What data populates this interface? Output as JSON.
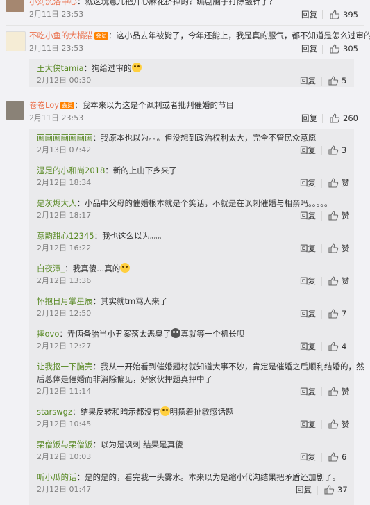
{
  "labels": {
    "reply": "回复"
  },
  "top_comments": [
    {
      "user": "小刘洗浴中心",
      "badge": "",
      "text": "：就这玩意儿把开心麻花挤掉的？编剧脑子打除皱针了？",
      "time": "2月11日 23:53",
      "likes": "395"
    },
    {
      "user": "不吃小鱼的大橘猫",
      "badge": "会员",
      "text": "：这小品去年被毙了，今年还能上，我是真的服气，都不知道是怎么过审的",
      "time": "2月11日 23:53",
      "likes": "305"
    },
    {
      "user": "卷卷Loy",
      "badge": "会员",
      "text": "：我本来以为这是个讽刺或者批判催婚的节目",
      "time": "2月11日 23:53",
      "likes": "260"
    }
  ],
  "replies_a": [
    {
      "user": "王大侠tamia",
      "text": "：狗给过审的",
      "time": "2月12日 00:30",
      "likes": "5",
      "emoji": "😆"
    }
  ],
  "replies_b": [
    {
      "user": "画画画画画画画",
      "text": "：我原本也以为。。。但没想到政治权利太大，完全不管民众意愿",
      "time": "2月13日 07:42",
      "likes": "3"
    },
    {
      "user": "湿足的小和尚2018",
      "text": "：新的上山下乡来了",
      "time": "2月12日 18:34",
      "likes": "赞"
    },
    {
      "user": "是灰烬大人",
      "text": "：小品中父母的催婚根本就是个笑话，不就是在讽刺催婚与相亲吗。。。。。",
      "time": "2月12日 18:17",
      "likes": "赞"
    },
    {
      "user": "意韵甜心12345",
      "text": "：我也这么以为。。。",
      "time": "2月12日 16:22",
      "likes": "赞"
    },
    {
      "user": "白夜潭_",
      "text": "：我真傻...真的",
      "time": "2月12日 13:36",
      "likes": "赞",
      "emoji": "😄"
    },
    {
      "user": "怀抱日月掌星辰",
      "text": "：其实就tm骂人来了",
      "time": "2月12日 12:50",
      "likes": "7"
    },
    {
      "user": "摔ovo",
      "text": "：弄俩备胎当小丑案落太恶臭了",
      "text2": "真就等一个机长呗",
      "time": "2月12日 12:27",
      "likes": "4",
      "emoji": "😱"
    },
    {
      "user": "让我抠一下脑壳",
      "text": "：我从一开始看到催婚题材就知道大事不妙，肯定是催婚之后顺利结婚的，然",
      "text_line2": "后总体是催婚而非消除偏见，好家伙押题真押中了",
      "time": "2月12日 11:14",
      "likes": "赞"
    },
    {
      "user": "starswgz",
      "text": "：结果反转和暗示都没有",
      "text2": "明摆着扯敏感话题",
      "time": "2月12日 10:45",
      "likes": "赞",
      "emoji": "😓"
    },
    {
      "user": "栗僧饭与栗僧饭",
      "text": "：以为是讽刺 结果是真傻",
      "time": "2月12日 10:03",
      "likes": "6"
    },
    {
      "user": "听小瓜的话",
      "text": "：是的是的，看完我一头雾水。本来以为是缩小代沟结果把矛盾还加剧了。",
      "time": "2月12日 01:47",
      "likes": "37"
    }
  ]
}
